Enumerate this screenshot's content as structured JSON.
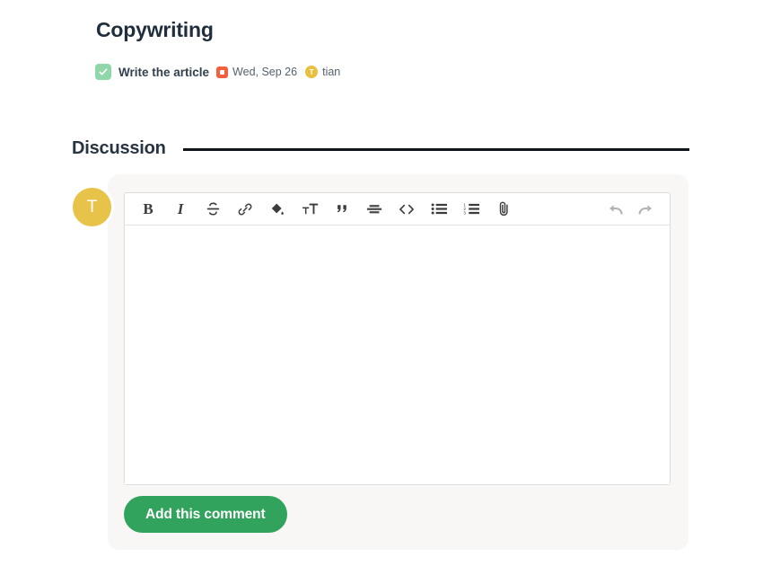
{
  "project": {
    "title": "Copywriting"
  },
  "task": {
    "completed": true,
    "check_icon": "check-icon",
    "name": "Write the article",
    "due_date_icon": "calendar-icon",
    "due_date": "Wed, Sep 26",
    "assignee_initial": "T",
    "assignee_name": "tian"
  },
  "discussion": {
    "heading": "Discussion"
  },
  "composer": {
    "avatar_initial": "T",
    "editor_value": "",
    "editor_placeholder": "",
    "submit_label": "Add this comment",
    "toolbar": {
      "left": [
        {
          "name": "bold-icon",
          "label": "B",
          "title": "Bold"
        },
        {
          "name": "italic-icon",
          "label": "I",
          "title": "Italic"
        },
        {
          "name": "strikethrough-icon",
          "label": "S",
          "title": "Strikethrough"
        },
        {
          "name": "link-icon",
          "label": "",
          "title": "Link"
        },
        {
          "name": "fill-color-icon",
          "label": "",
          "title": "Text background color"
        },
        {
          "name": "text-size-icon",
          "label": "",
          "title": "Text size"
        },
        {
          "name": "blockquote-icon",
          "label": "”",
          "title": "Quote"
        },
        {
          "name": "align-center-icon",
          "label": "",
          "title": "Alignment"
        },
        {
          "name": "code-icon",
          "label": "< >",
          "title": "Code"
        },
        {
          "name": "bulleted-list-icon",
          "label": "",
          "title": "Bulleted list"
        },
        {
          "name": "numbered-list-icon",
          "label": "",
          "title": "Numbered list"
        },
        {
          "name": "attachment-icon",
          "label": "",
          "title": "Attach file"
        }
      ],
      "right": [
        {
          "name": "undo-icon",
          "label": "",
          "title": "Undo"
        },
        {
          "name": "redo-icon",
          "label": "",
          "title": "Redo"
        }
      ]
    }
  },
  "colors": {
    "page_background": "#ffffff",
    "card_background": "#f8f7f5",
    "accent_green": "#32a35c",
    "checkbox_green": "#8fd6a8",
    "avatar_yellow": "#e8c34a",
    "date_red": "#f4603e",
    "rule_dark": "#11161c",
    "text_primary": "#2b3440",
    "text_secondary": "#56616d"
  }
}
